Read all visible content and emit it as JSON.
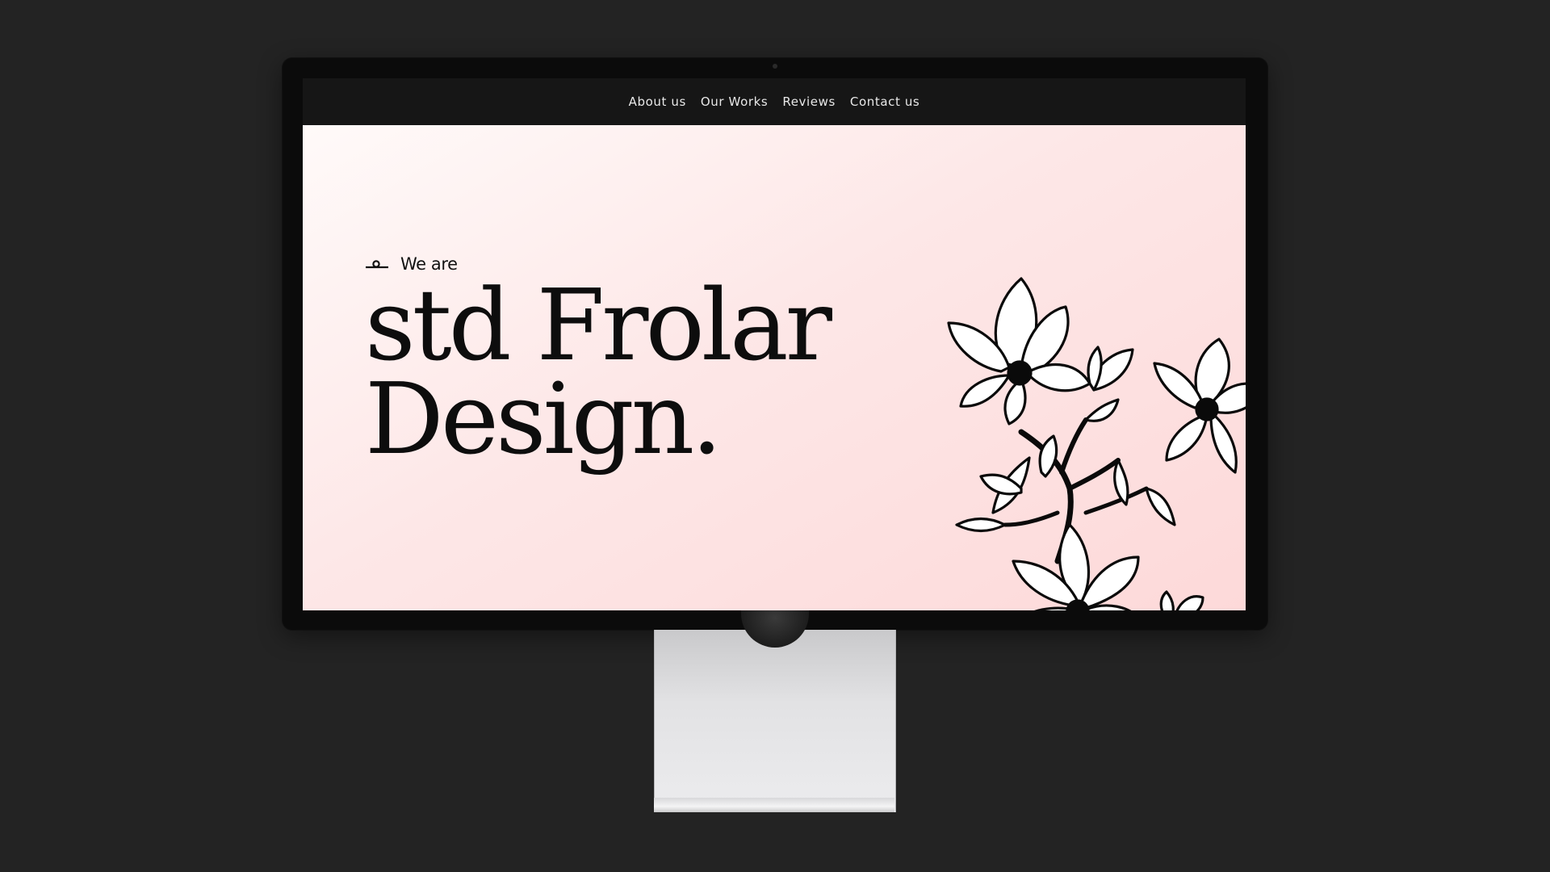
{
  "nav": {
    "items": [
      {
        "label": "About us"
      },
      {
        "label": "Our Works"
      },
      {
        "label": "Reviews"
      },
      {
        "label": "Contact us"
      }
    ]
  },
  "hero": {
    "eyebrow": "We are",
    "eyebrow_icon": "logo-mark-icon",
    "headline_line1": "std Frolar",
    "headline_line2": "Design.",
    "illustration": "magnolia-flowers-illustration"
  },
  "colors": {
    "page_background": "#232323",
    "monitor_bezel": "#0b0b0b",
    "navbar": "#161616",
    "hero_gradient_start": "#fffaf9",
    "hero_gradient_end": "#fdd9d9",
    "text_primary": "#0d0d0d"
  }
}
